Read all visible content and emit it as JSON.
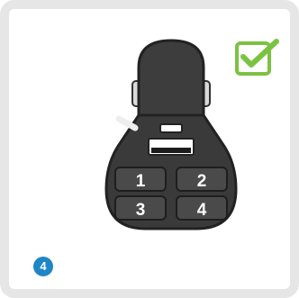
{
  "step": {
    "number": "4"
  },
  "buttons": [
    {
      "label": "1"
    },
    {
      "label": "2"
    },
    {
      "label": "3"
    },
    {
      "label": "4"
    }
  ],
  "icons": {
    "status": "green-check-icon",
    "device": "car-charger-keypad-icon",
    "step": "step-number-badge"
  },
  "colors": {
    "check_green": "#7cc242",
    "step_blue": "#1f86c5",
    "device_dark": "#3a3a3a",
    "card_border": "#e6e6e6"
  }
}
